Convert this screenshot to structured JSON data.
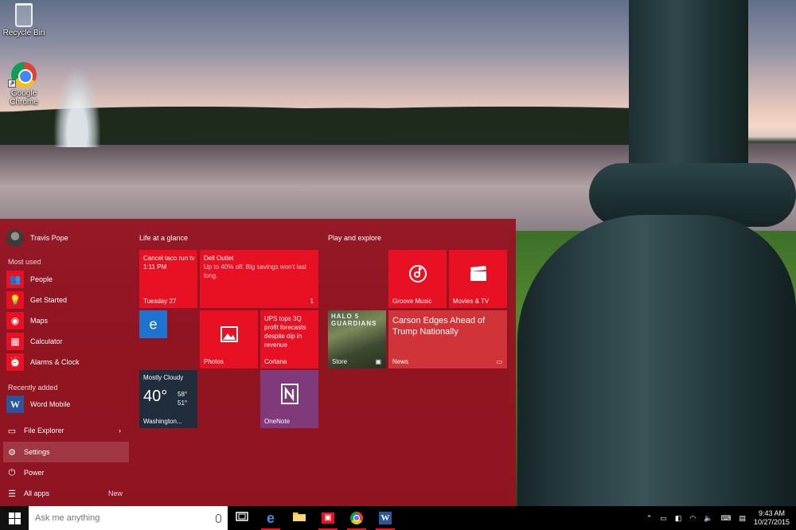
{
  "desktop": {
    "icons": [
      {
        "label": "Recycle Bin",
        "icon": "recycle-bin-icon"
      },
      {
        "label": "Google Chrome",
        "icon": "chrome-icon"
      }
    ]
  },
  "start_menu": {
    "user": {
      "name": "Travis Pope"
    },
    "most_used_label": "Most used",
    "most_used": [
      {
        "label": "People",
        "icon": "people-icon"
      },
      {
        "label": "Get Started",
        "icon": "lightbulb-icon"
      },
      {
        "label": "Maps",
        "icon": "maps-icon"
      },
      {
        "label": "Calculator",
        "icon": "calculator-icon"
      },
      {
        "label": "Alarms & Clock",
        "icon": "alarm-icon"
      }
    ],
    "recently_added_label": "Recently added",
    "recently_added": [
      {
        "label": "Word Mobile",
        "icon": "word-icon"
      }
    ],
    "system": [
      {
        "label": "File Explorer",
        "icon": "folder-icon",
        "chevron": "›"
      },
      {
        "label": "Settings",
        "icon": "gear-icon"
      },
      {
        "label": "Power",
        "icon": "power-icon"
      },
      {
        "label": "All apps",
        "icon": "list-icon",
        "badge": "New"
      }
    ],
    "groups": {
      "life": "Life at a glance",
      "play": "Play and explore"
    },
    "tiles": {
      "calendar": {
        "line1": "Cancel taco run tv",
        "line2": "1:11 PM",
        "caption": "Tuesday 27"
      },
      "mail": {
        "line1": "Dell Outlet",
        "line2": "Up to 40% off. Big savings won't last long.",
        "count": "1"
      },
      "edge": {
        "glyph": "e"
      },
      "photos": {
        "caption": "Photos"
      },
      "cortana": {
        "headline": "UPS tops 3Q profit forecasts despite dip in revenue",
        "caption": "Cortana"
      },
      "weather": {
        "condition": "Mostly Cloudy",
        "temp": "40°",
        "high": "58°",
        "low": "51°",
        "caption": "Washington..."
      },
      "onenote": {
        "caption": "OneNote"
      },
      "groove": {
        "caption": "Groove Music"
      },
      "movies": {
        "caption": "Movies & TV"
      },
      "store": {
        "game": "HALO 5 GUARDIANS",
        "caption": "Store"
      },
      "news": {
        "headline": "Carson Edges Ahead of Trump Nationally",
        "caption": "News"
      }
    }
  },
  "taskbar": {
    "search_placeholder": "Ask me anything",
    "pinned": [
      "task-view-icon",
      "edge-icon",
      "file-explorer-icon",
      "store-icon",
      "chrome-icon",
      "word-icon"
    ],
    "clock_time": "9:43 AM",
    "clock_date": "10/27/2015"
  },
  "colors": {
    "accent": "#e81123",
    "start_bg": "#96121f",
    "onenote": "#80397b",
    "weather": "#1f2d3d",
    "edge": "#1e73d0"
  }
}
